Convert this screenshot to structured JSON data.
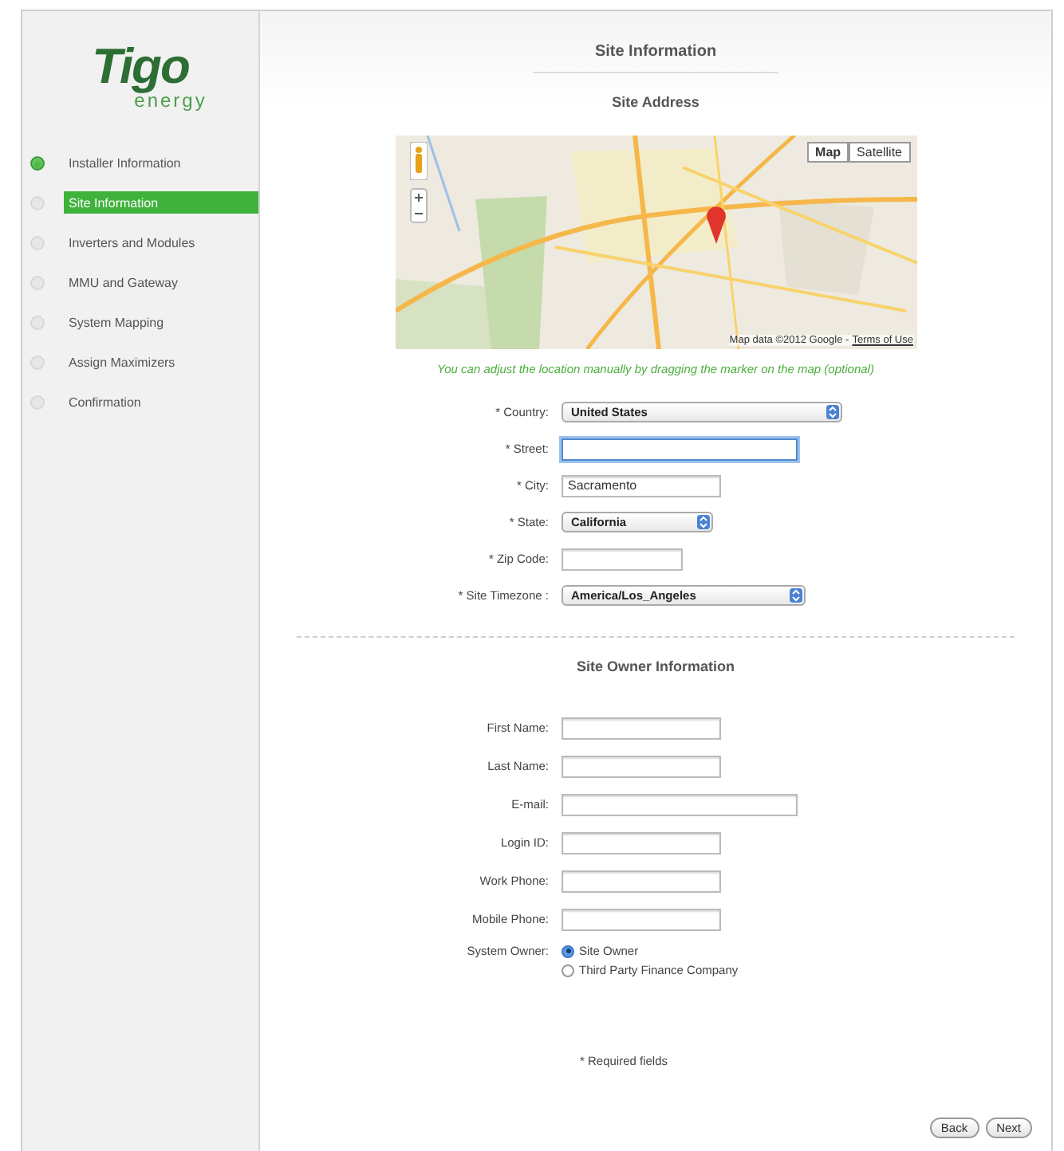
{
  "logo": {
    "name": "Tigo",
    "subtitle": "energy"
  },
  "steps": [
    {
      "label": "Installer Information",
      "completed": true,
      "selected": false
    },
    {
      "label": "Site Information",
      "completed": false,
      "selected": true
    },
    {
      "label": "Inverters and Modules",
      "completed": false,
      "selected": false
    },
    {
      "label": "MMU and Gateway",
      "completed": false,
      "selected": false
    },
    {
      "label": "System Mapping",
      "completed": false,
      "selected": false
    },
    {
      "label": "Assign Maximizers",
      "completed": false,
      "selected": false
    },
    {
      "label": "Confirmation",
      "completed": false,
      "selected": false
    }
  ],
  "page_title": "Site Information",
  "site_address": {
    "heading": "Site Address",
    "map": {
      "map_types": [
        {
          "label": "Map",
          "selected": true
        },
        {
          "label": "Satellite",
          "selected": false
        }
      ],
      "attribution": "Map data ©2012 Google -",
      "terms_link": "Terms of Use"
    },
    "hint": "You can adjust the location manually by dragging the marker on the map (optional)",
    "fields": [
      {
        "label": "* Country:",
        "kind": "select",
        "value": "United States"
      },
      {
        "label": "* Street:",
        "kind": "text",
        "focused": true
      },
      {
        "label": "* City:",
        "kind": "text",
        "value": "Sacramento",
        "focused": false
      },
      {
        "label": "* State:",
        "kind": "select",
        "value": "California"
      },
      {
        "label": "* Zip Code:",
        "kind": "text",
        "focused": false
      },
      {
        "label": "* Site Timezone :",
        "kind": "select",
        "value": "America/Los_Angeles"
      }
    ]
  },
  "site_owner": {
    "heading": "Site Owner Information",
    "fields": [
      {
        "label": "First Name:",
        "kind": "text",
        "focused": false
      },
      {
        "label": "Last Name:",
        "kind": "text",
        "focused": false
      },
      {
        "label": "E-mail:",
        "kind": "text",
        "focused": false
      },
      {
        "label": "Login ID:",
        "kind": "text",
        "focused": false
      },
      {
        "label": "Work Phone:",
        "kind": "text",
        "focused": false
      },
      {
        "label": "Mobile Phone:",
        "kind": "text",
        "focused": false
      }
    ],
    "system_owner": {
      "label": "System Owner:",
      "options": [
        {
          "label": "Site Owner",
          "selected": true
        },
        {
          "label": "Third Party Finance Company",
          "selected": false
        }
      ]
    }
  },
  "required_note": "* Required fields",
  "buttons": [
    "Back",
    "Next"
  ]
}
